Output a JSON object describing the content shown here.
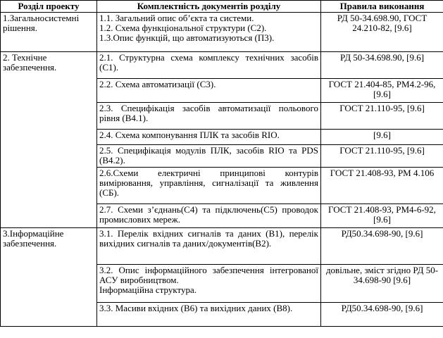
{
  "headers": {
    "section": "Розділ проекту",
    "docs": "Комплектність документів розділу",
    "rules": "Правила виконання"
  },
  "rows": [
    {
      "section": "1.Загальносистемні рішення.",
      "docs": [
        "1.1. Загальний опис об’єкта та системи.",
        "1.2. Схема функціональної структури (С2).",
        "1.3.Опис функцій, що автоматизуються (П3)."
      ],
      "rules": "РД 50-34.698.90, ГОСТ 24.210-82, [9.6]"
    },
    {
      "section": "2. Технічне забезпечення.",
      "docs": [
        "2.1. Структурна схема комплексу технічних засобів (С1)."
      ],
      "rules": "РД 50-34.698.90, [9.6]"
    },
    {
      "section": "",
      "docs": [
        "2.2. Схема автоматизації (С3)."
      ],
      "rules": "ГОСТ 21.404-85, РМ4.2-96, [9.6]"
    },
    {
      "section": "",
      "docs": [
        "2.3. Специфікація засобів автоматизації польового рівня (В4.1)."
      ],
      "rules": "ГОСТ 21.110-95, [9.6]"
    },
    {
      "section": "",
      "docs": [
        "2.4. Схема компонування ПЛК та засобів RIO."
      ],
      "rules": "[9.6]"
    },
    {
      "section": "",
      "docs": [
        "2.5. Специфікація модулів ПЛК, засобів RIO та PDS (В4.2)."
      ],
      "rules": "ГОСТ 21.110-95, [9.6]"
    },
    {
      "section": "",
      "docs": [
        "2.6.Схеми електричні принципові контурів вимірювання, управління, сигналізації та живлення (СБ)."
      ],
      "rules": "ГОСТ 21.408-93, РМ 4.106"
    },
    {
      "section": "",
      "docs": [
        "2.7. Схеми з’єднань(С4) та підключень(С5) проводок промислових мереж."
      ],
      "rules": "ГОСТ 21.408-93, РМ4-6-92, [9.6]"
    },
    {
      "section": "3.Інформаційне забезпечення.",
      "docs": [
        "3.1. Перелік вхідних сигналів та даних (В1), перелік вихідних сигналів та даних/документів(В2)."
      ],
      "rules": "РД50.34.698-90, [9.6]"
    },
    {
      "section": "",
      "docs": [
        "3.2. Опис інформаційного забезпечення інтегрованої АСУ виробництвом.",
        "Інформаційна структура."
      ],
      "rules": "довільне, зміст згідно РД 50-34.698-90 [9.6]"
    },
    {
      "section": "",
      "docs": [
        "3.3. Масиви вхідних (В6) та вихідних даних (В8)."
      ],
      "rules": "РД50.34.698-90, [9.6]"
    }
  ]
}
